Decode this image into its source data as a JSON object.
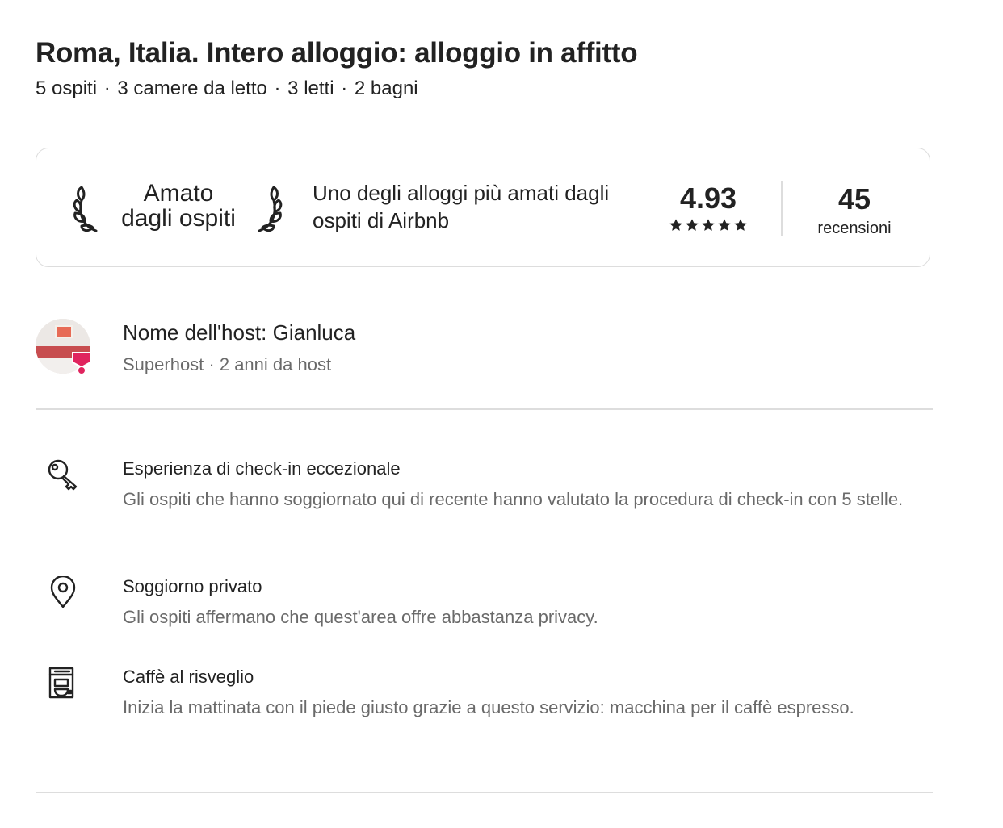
{
  "listing": {
    "title": "Roma, Italia. Intero alloggio: alloggio in affitto",
    "details": [
      "5 ospiti",
      "3 camere da letto",
      "3 letti",
      "2 bagni"
    ],
    "separator": "·"
  },
  "guest_favorite": {
    "badge_line1": "Amato",
    "badge_line2": "dagli ospiti",
    "description": "Uno degli alloggi più amati dagli ospiti di Airbnb",
    "rating": "4.93",
    "stars": 5,
    "reviews_count": "45",
    "reviews_label": "recensioni",
    "icons": [
      "laurel-left-icon",
      "laurel-right-icon",
      "star-icon"
    ]
  },
  "host": {
    "name_label": "Nome dell'host: Gianluca",
    "meta": "Superhost · 2 anni da host",
    "badge_color": "#e0245e"
  },
  "highlights": [
    {
      "icon": "key-icon",
      "title": "Esperienza di check-in eccezionale",
      "description": "Gli ospiti che hanno soggiornato qui di recente hanno valutato la procedura di check-in con 5 stelle."
    },
    {
      "icon": "location-pin-icon",
      "title": "Soggiorno privato",
      "description": "Gli ospiti affermano che quest'area offre abbastanza privacy."
    },
    {
      "icon": "coffee-machine-icon",
      "title": "Caffè al risveglio",
      "description": "Inizia la mattinata con il piede giusto grazie a questo servizio: macchina per il caffè espresso."
    }
  ],
  "colors": {
    "text": "#222222",
    "secondary_text": "#6a6a6a",
    "border": "#dddddd",
    "superhost_accent": "#e0245e"
  }
}
